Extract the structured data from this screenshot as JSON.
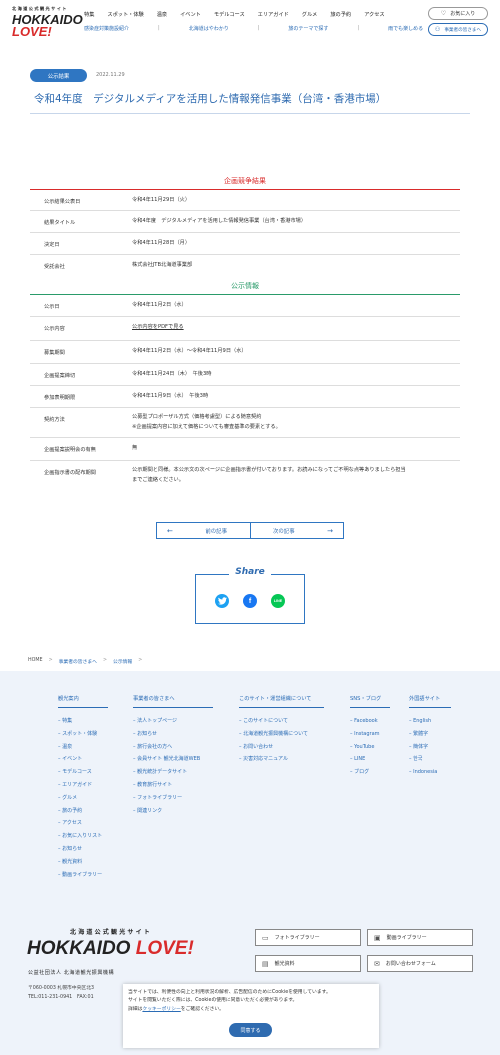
{
  "header": {
    "logo": {
      "tagline": "北海道公式観光サイト",
      "name_line1": "HOKKAIDO",
      "name_line2": "LOVE!"
    },
    "nav_main": [
      "特集",
      "スポット・体験",
      "温泉",
      "イベント",
      "モデルコース",
      "エリアガイド",
      "グルメ",
      "旅の予約",
      "アクセス"
    ],
    "nav_sub": [
      "感染症対策施設紹介",
      "北海道はやわかり",
      "旅のテーマで探す",
      "雨でも楽しめる"
    ],
    "favorites_label": "お気に入り",
    "business_label": "事業者の皆さまへ"
  },
  "article": {
    "badge": "公示結果",
    "date": "2022.11.29",
    "title": "令和4年度　デジタルメディアを活用した情報発信事業（台湾・香港市場）"
  },
  "results": {
    "heading": "企画競争結果",
    "rows": [
      {
        "key": "公示結果公表日",
        "value": "令和4年11月29日（火）"
      },
      {
        "key": "結果タイトル",
        "value": "令和4年度　デジタルメディアを活用した情報発信事業（台湾・香港市場）"
      },
      {
        "key": "決定日",
        "value": "令和4年11月28日（月）"
      },
      {
        "key": "受託会社",
        "value": "株式会社JTB北海道事業部"
      }
    ]
  },
  "notice": {
    "heading": "公示情報",
    "rows": [
      {
        "key": "公示日",
        "value": "令和4年11月2日（水）"
      },
      {
        "key": "公示内容",
        "value": "公示内容をPDFで見る"
      },
      {
        "key": "募集期間",
        "value": "令和4年11月2日（水）〜令和4年11月9日（水）"
      },
      {
        "key": "企画提案締切",
        "value": "令和4年11月24日（木）　午後3時"
      },
      {
        "key": "参加表明期限",
        "value": "令和4年11月9日（水）　午後3時"
      },
      {
        "key": "契約方法",
        "value": "公募型プロポーザル方式（価格考慮型）による随意契約",
        "value2": "※企画提案内容に加えて価格についても審査基準の要素とする。"
      },
      {
        "key": "企画提案説明会の有無",
        "value": "無"
      },
      {
        "key": "企画指示書の配布期間",
        "value": "公示期間と同様。本公示文の次ページに企画指示書が付いております。お読みになってご不明な点等ありましたら担当",
        "value2": "までご連絡ください。"
      }
    ]
  },
  "pager": {
    "prev": "前の記事",
    "next": "次の記事"
  },
  "share": {
    "title": "Share",
    "icons": [
      "twitter-icon",
      "facebook-icon",
      "line-icon"
    ],
    "colors": {
      "twitter": "#1da1f2",
      "facebook": "#1877f2",
      "line": "#06c755"
    }
  },
  "breadcrumb": [
    "HOME",
    "事業者の皆さまへ",
    "公示情報"
  ],
  "sitemap": [
    {
      "heading": "観光案内",
      "items": [
        "特集",
        "スポット・体験",
        "温泉",
        "イベント",
        "モデルコース",
        "エリアガイド",
        "グルメ",
        "旅の予約",
        "アクセス",
        "お気に入りリスト",
        "お知らせ",
        "観光資料",
        "動画ライブラリー"
      ]
    },
    {
      "heading": "事業者の皆さまへ",
      "items": [
        "法人トップページ",
        "お知らせ",
        "旅行会社の方へ",
        "会員サイト 観光北海道WEB",
        "観光統計データサイト",
        "教育旅行サイト",
        "フォトライブラリー",
        "関連リンク"
      ]
    },
    {
      "heading": "このサイト・運営組織について",
      "items": [
        "このサイトについて",
        "北海道観光振興機構について",
        "お問い合わせ",
        "災害対応マニュアル"
      ]
    },
    {
      "heading": "SNS・ブログ",
      "items": [
        "Facebook",
        "Instagram",
        "YouTube",
        "LINE",
        "ブログ"
      ]
    },
    {
      "heading": "外国語サイト",
      "items": [
        "English",
        "繁體字",
        "簡体字",
        "한국",
        "Indonesia"
      ]
    }
  ],
  "footer": {
    "tagline": "北海道公式観光サイト",
    "logo_a": "HOKKAIDO ",
    "logo_b": "LOVE!",
    "org": "公益社団法人 北海道観光振興機構",
    "address": "〒060-0003 札幌市中央区北3",
    "tel": "TEL:011-231-0941　FAX:01",
    "buttons": [
      "フォトライブラリー",
      "動画ライブラリー",
      "観光資料",
      "お問い合わせフォーム"
    ]
  },
  "cookie": {
    "line1": "当サイトでは、利便性の向上と利用状況の解析、広告配信のためにCookieを使用しています。",
    "line2": "サイトを閲覧いただく際には、Cookieの使用に同意いただく必要があります。",
    "line3_pre": "詳細は",
    "line3_link": "クッキーポリシー",
    "line3_post": "をご確認ください。",
    "accept": "同意する"
  }
}
